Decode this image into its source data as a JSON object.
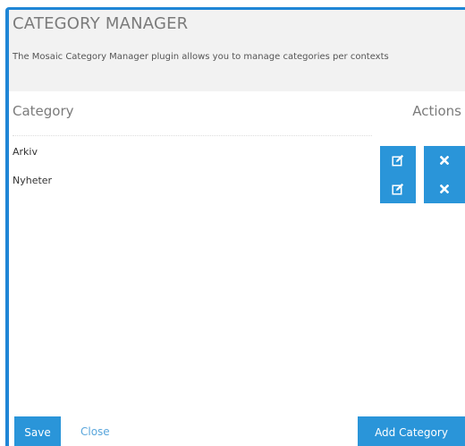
{
  "dialog": {
    "title": "CATEGORY MANAGER",
    "description": "The Mosaic Category Manager plugin allows you to manage categories per contexts"
  },
  "table": {
    "columns": {
      "category": "Category",
      "actions": "Actions"
    },
    "rows": [
      {
        "name": "Arkiv",
        "edit_icon": "edit-icon",
        "delete_icon": "close-icon"
      },
      {
        "name": "Nyheter",
        "edit_icon": "edit-icon",
        "delete_icon": "close-icon"
      }
    ]
  },
  "footer": {
    "save_label": "Save",
    "close_label": "Close",
    "add_label": "Add Category"
  },
  "colors": {
    "accent": "#1f86d6",
    "button": "#2a95d9",
    "header_bg": "#f2f2f2",
    "link": "#5aa6dc"
  }
}
